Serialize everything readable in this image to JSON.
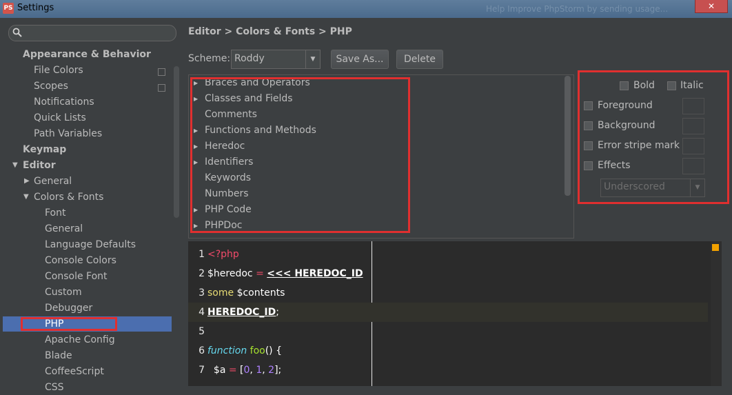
{
  "window": {
    "title": "Settings",
    "blurred_text": "Help Improve PhpStorm by sending usage..."
  },
  "search": {
    "placeholder": ""
  },
  "tree": {
    "appearance": "Appearance & Behavior",
    "file_colors": "File Colors",
    "scopes": "Scopes",
    "notifications": "Notifications",
    "quick_lists": "Quick Lists",
    "path_variables": "Path Variables",
    "keymap": "Keymap",
    "editor": "Editor",
    "general": "General",
    "colors_fonts": "Colors & Fonts",
    "font": "Font",
    "general2": "General",
    "language_defaults": "Language Defaults",
    "console_colors": "Console Colors",
    "console_font": "Console Font",
    "custom": "Custom",
    "debugger": "Debugger",
    "php": "PHP",
    "apache_config": "Apache Config",
    "blade": "Blade",
    "coffeescript": "CoffeeScript",
    "css": "CSS"
  },
  "breadcrumb": "Editor > Colors & Fonts > PHP",
  "scheme": {
    "label": "Scheme:",
    "value": "Roddy",
    "save_as": "Save As...",
    "delete": "Delete"
  },
  "categories": [
    "Braces and Operators",
    "Classes and Fields",
    "Comments",
    "Functions and Methods",
    "Heredoc",
    "Identifiers",
    "Keywords",
    "Numbers",
    "PHP Code",
    "PHPDoc"
  ],
  "options": {
    "bold": "Bold",
    "italic": "Italic",
    "foreground": "Foreground",
    "background": "Background",
    "error_stripe": "Error stripe mark",
    "effects": "Effects",
    "effect_type": "Underscored"
  },
  "code": {
    "l1": {
      "n": "1",
      "tag": "<?php"
    },
    "l2": {
      "n": "2",
      "var": "$heredoc ",
      "op": "=",
      "sp": " ",
      "hd": "<<< HEREDOC_ID"
    },
    "l3": {
      "n": "3",
      "str": "some ",
      "var": "$contents"
    },
    "l4": {
      "n": "4",
      "hd": "HEREDOC_ID",
      "semi": ";"
    },
    "l5": {
      "n": "5"
    },
    "l6": {
      "n": "6",
      "kw": "function",
      "sp": " ",
      "fname": "foo",
      "rest": "() {"
    },
    "l7": {
      "n": "7",
      "var": "$a ",
      "op": "=",
      "open": " [",
      "n0": "0",
      "c1": ", ",
      "n1": "1",
      "c2": ", ",
      "n2": "2",
      "close": "];"
    }
  },
  "colors": {
    "selection": "#4b6eaf",
    "highlight_box": "#e02f2f",
    "editor_bg": "#2b2b2b",
    "marker": "#f2a100"
  }
}
